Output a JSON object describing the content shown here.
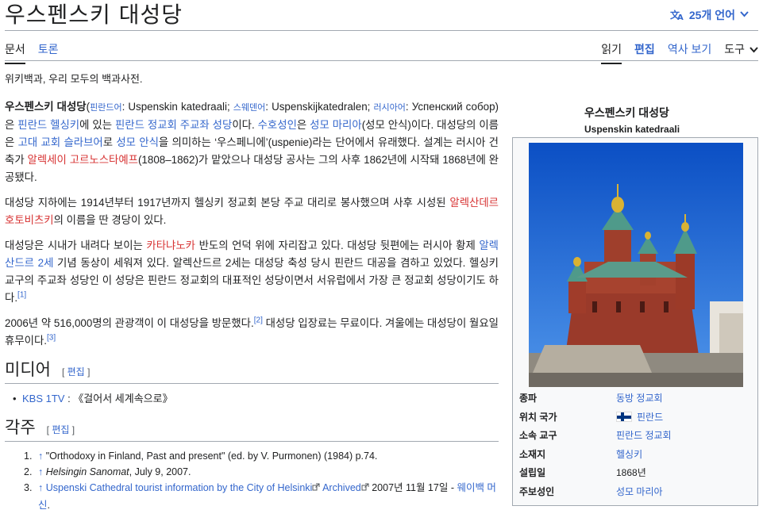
{
  "header": {
    "title": "우스펜스키 대성당",
    "language_button": "25개 언어"
  },
  "tabs": {
    "left": [
      "문서",
      "토론"
    ],
    "right": [
      "읽기",
      "편집",
      "역사 보기"
    ],
    "tools": "도구"
  },
  "tagline": "위키백과, 우리 모두의 백과사전.",
  "paragraphs": {
    "p1": {
      "bold_title": "우스펜스키 대성당",
      "a": "(",
      "fi_lang": "핀란드어",
      "fi_text": ": Uspenskin katedraali; ",
      "sv_lang": "스웨덴어",
      "sv_text": ": Uspenskijkatedralen; ",
      "ru_lang": "러시아어",
      "ru_text": ": Успенский собор)은 ",
      "finland": "핀란드",
      "space1": " ",
      "helsinki": "헬싱키",
      "t1": "에 있는 ",
      "church": "핀란드 정교회 주교좌 성당",
      "t2": "이다. ",
      "patron": "수호성인",
      "t3": "은 ",
      "mary": "성모 마리아",
      "t4": "(성모 안식)이다. 대성당의 이름은 ",
      "slavonic": "고대 교회 슬라브어",
      "t5": "로 ",
      "dormition": "성모 안식",
      "t6": "을 의미하는 ‘우스페니에’(uspenie)라는 단어에서 유래했다. 설계는 러시아 건축가 ",
      "architect": "알렉세이 고르노스타예프",
      "t7": "(1808–1862)가 맡았으나 대성당 공사는 그의 사후 1862년에 시작돼 1868년에 완공됐다."
    },
    "p2": {
      "t1": "대성당 지하에는 1914년부터 1917년까지 헬싱키 정교회 본당 주교 대리로 봉사했으며 사후 시성된 ",
      "saint": "알렉산데르 호토비츠키",
      "t2": "의 이름을 딴 경당이 있다."
    },
    "p3": {
      "t1": "대성당은 시내가 내려다 보이는 ",
      "peninsula": "카타냐노카",
      "t2": " 반도의 언덕 위에 자리잡고 있다. 대성당 뒷편에는 러시아 황제 ",
      "tsar": "알렉산드르 2세",
      "t3": " 기념 동상이 세워져 있다. 알렉산드르 2세는 대성당 축성 당시 핀란드 대공을 겸하고 있었다. 헬싱키 교구의 주교좌 성당인 이 성당은 핀란드 정교회의 대표적인 성당이면서 서유럽에서 가장 큰 정교회 성당이기도 하다.",
      "ref": "[1]"
    },
    "p4": {
      "t1": "2006년 약 516,000명의 관광객이 이 대성당을 방문했다.",
      "ref1": "[2]",
      "t2": " 대성당 입장료는 무료이다. 겨울에는 대성당이 월요일 휴무이다.",
      "ref2": "[3]"
    }
  },
  "sections": {
    "media": {
      "heading": "미디어",
      "edit_open": "[ ",
      "edit_label": "편집",
      "edit_close": " ]",
      "item_link": "KBS 1TV",
      "item_text": " : 《걸어서 세계속으로》"
    },
    "notes": {
      "heading": "각주",
      "edit_open": "[ ",
      "edit_label": "편집",
      "edit_close": " ]",
      "refs": [
        {
          "num": "1.",
          "arrow": "↑",
          "text": "\"Orthodoxy in Finland, Past and present\" (ed. by V. Purmonen) (1984) p.74."
        },
        {
          "num": "2.",
          "arrow": "↑",
          "italic": "Helsingin Sanomat",
          "text": ", July 9, 2007."
        },
        {
          "num": "3.",
          "arrow": "↑",
          "link": "Uspenski Cathedral tourist information by the City of Helsinki",
          "archived": "Archived",
          "text": " 2007년 11월 17일 - ",
          "link2": "웨이백 머신",
          "tail": "."
        }
      ]
    }
  },
  "infobox": {
    "name_ko": "우스펜스키 대성당",
    "name_local": "Uspenskin katedraali",
    "rows": [
      {
        "key": "종파",
        "value": "동방 정교회"
      },
      {
        "key": "위치 국가",
        "value": "핀란드"
      },
      {
        "key": "소속 교구",
        "value": "핀란드 정교회"
      },
      {
        "key": "소재지",
        "value": "헬싱키"
      },
      {
        "key": "설립일",
        "value": "1868년"
      },
      {
        "key": "주보성인",
        "value": "성모 마리아"
      }
    ]
  },
  "colors": {
    "link": "#3366cc",
    "redlink": "#d73333",
    "text": "#202122",
    "infobox_bg": "#f8f9fa",
    "border": "#a2a9b1"
  },
  "icons": {
    "language": "translate-icon",
    "dropdown": "chevron-down-icon",
    "external": "external-link-icon",
    "flag": "finland-flag-icon"
  }
}
